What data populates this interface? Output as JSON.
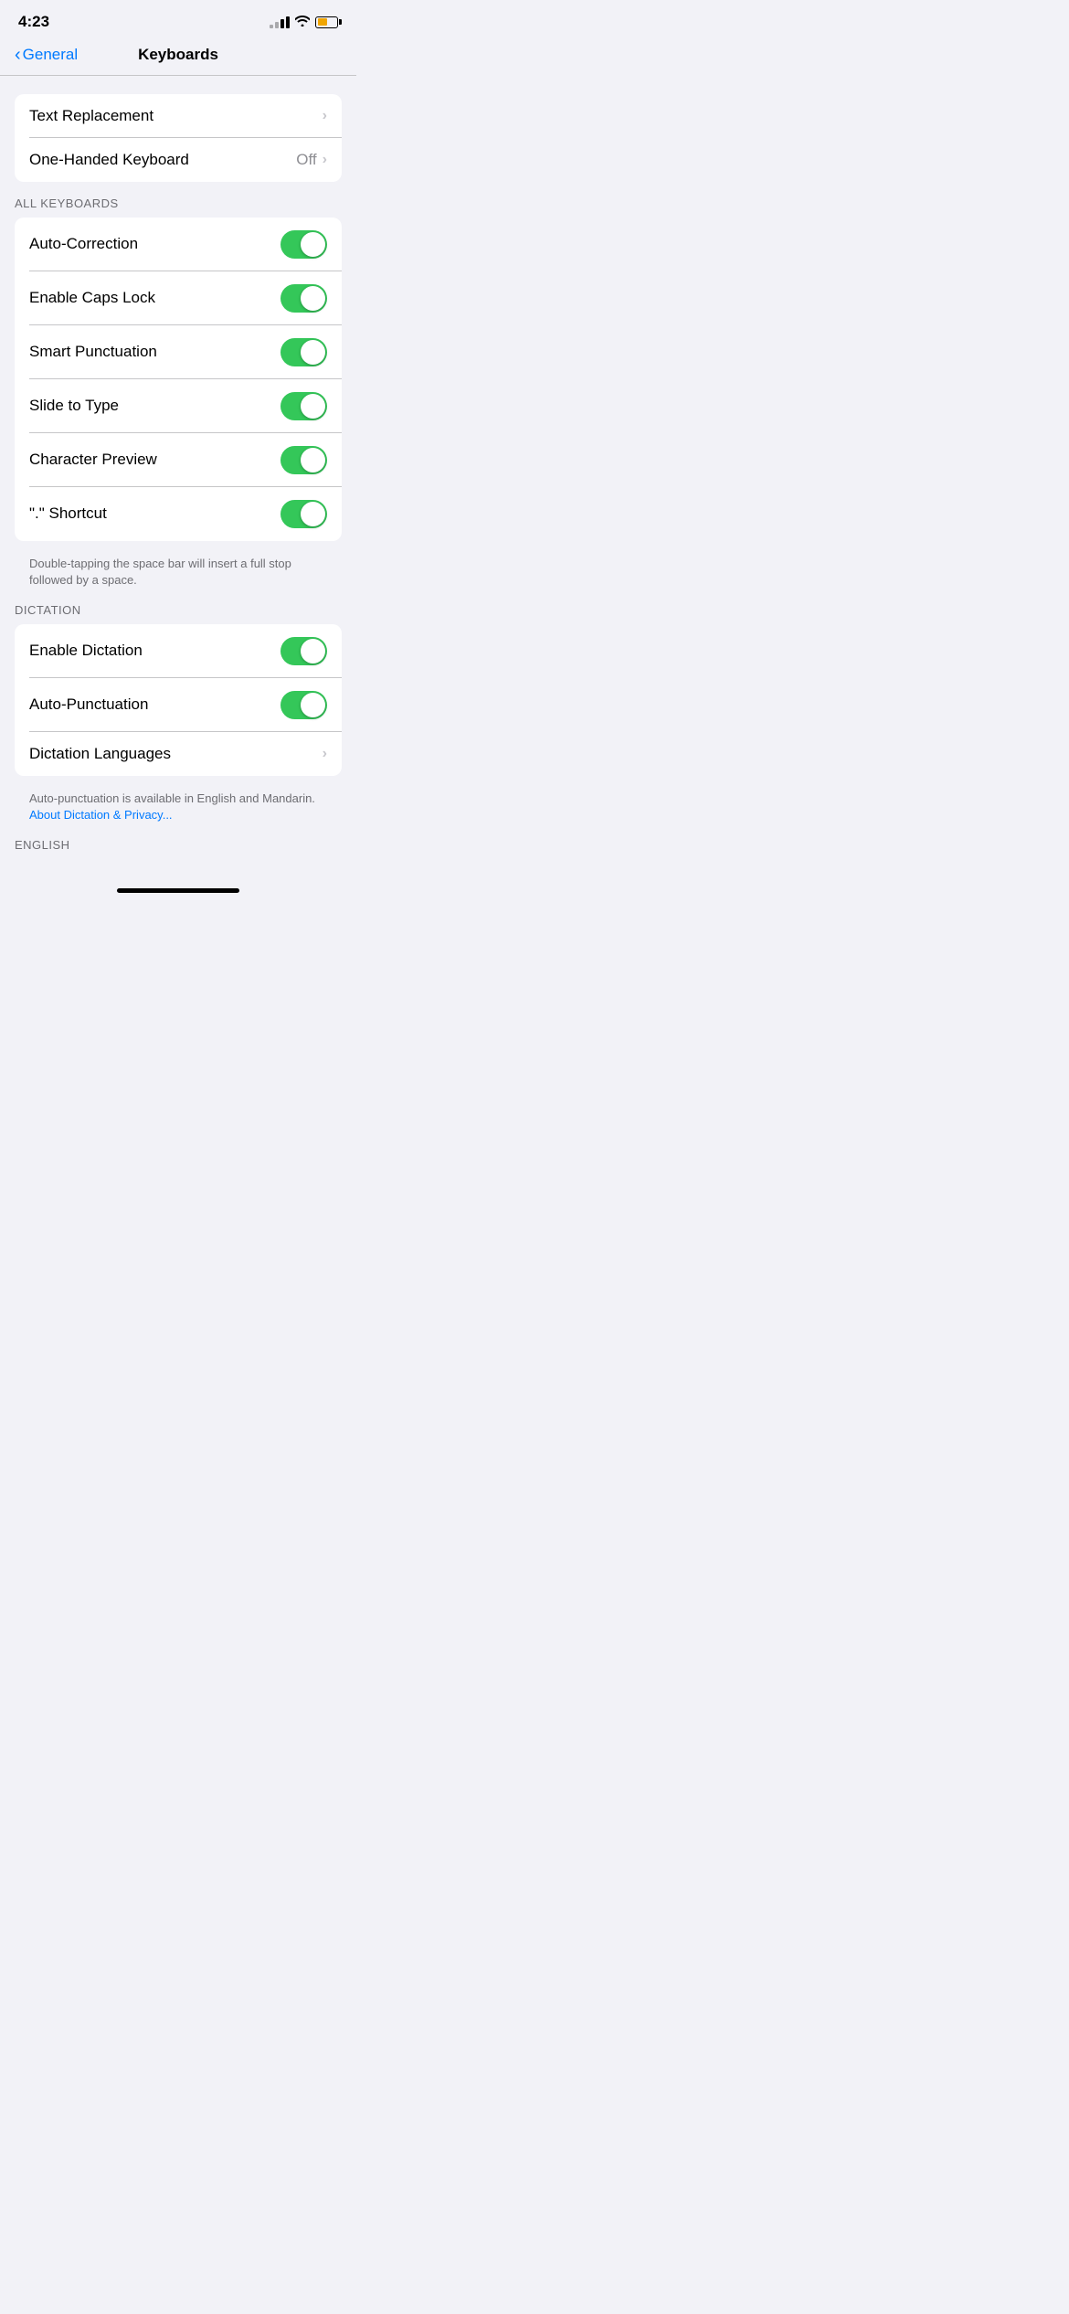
{
  "statusBar": {
    "time": "4:23"
  },
  "nav": {
    "backLabel": "General",
    "title": "Keyboards"
  },
  "mainSection": {
    "items": [
      {
        "id": "text-replacement",
        "label": "Text Replacement",
        "type": "link"
      },
      {
        "id": "one-handed-keyboard",
        "label": "One-Handed Keyboard",
        "type": "link-value",
        "value": "Off"
      }
    ]
  },
  "allKeyboardsSection": {
    "label": "ALL KEYBOARDS",
    "items": [
      {
        "id": "auto-correction",
        "label": "Auto-Correction",
        "type": "toggle",
        "on": true
      },
      {
        "id": "enable-caps-lock",
        "label": "Enable Caps Lock",
        "type": "toggle",
        "on": true
      },
      {
        "id": "smart-punctuation",
        "label": "Smart Punctuation",
        "type": "toggle",
        "on": true
      },
      {
        "id": "slide-to-type",
        "label": "Slide to Type",
        "type": "toggle",
        "on": true
      },
      {
        "id": "character-preview",
        "label": "Character Preview",
        "type": "toggle",
        "on": true
      },
      {
        "id": "period-shortcut",
        "label": "“.” Shortcut",
        "type": "toggle",
        "on": true
      }
    ],
    "note": "Double-tapping the space bar will insert a full stop followed by a space."
  },
  "dictationSection": {
    "label": "DICTATION",
    "items": [
      {
        "id": "enable-dictation",
        "label": "Enable Dictation",
        "type": "toggle",
        "on": true
      },
      {
        "id": "auto-punctuation",
        "label": "Auto-Punctuation",
        "type": "toggle",
        "on": true
      },
      {
        "id": "dictation-languages",
        "label": "Dictation Languages",
        "type": "link"
      }
    ],
    "notePrefix": "Auto-punctuation is available in English and Mandarin. ",
    "noteLink": "About Dictation & Privacy..."
  },
  "englishSection": {
    "label": "ENGLISH"
  }
}
